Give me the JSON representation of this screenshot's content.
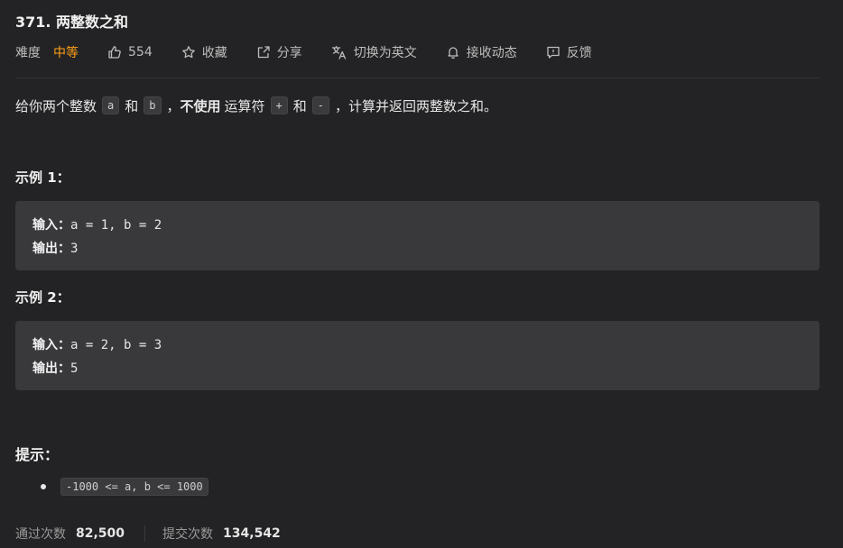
{
  "problem": {
    "title": "371. 两整数之和"
  },
  "meta": {
    "difficulty_label": "难度",
    "difficulty": "中等",
    "difficulty_color": "#ffa116",
    "likes": "554",
    "actions": [
      {
        "label": "收藏",
        "icon": "star-icon"
      },
      {
        "label": "分享",
        "icon": "share-icon"
      },
      {
        "label": "切换为英文",
        "icon": "translate-icon"
      },
      {
        "label": "接收动态",
        "icon": "bell-icon"
      },
      {
        "label": "反馈",
        "icon": "feedback-icon"
      }
    ]
  },
  "description": {
    "part1": "给你两个整数",
    "code_a": "a",
    "and1": "和",
    "code_b": "b",
    "comma1": "，",
    "bold": "不使用",
    "part2": "运算符",
    "code_plus": "+",
    "and2": "和",
    "code_minus": "-",
    "part3": "，计算并返回两整数之和。"
  },
  "examples": [
    {
      "title": "示例 1：",
      "input_label": "输入：",
      "input": "a = 1, b = 2",
      "output_label": "输出：",
      "output": "3"
    },
    {
      "title": "示例 2：",
      "input_label": "输入：",
      "input": "a = 2, b = 3",
      "output_label": "输出：",
      "output": "5"
    }
  ],
  "hints": {
    "title": "提示：",
    "items": [
      "-1000 <= a, b <= 1000"
    ]
  },
  "stats": {
    "passed_label": "通过次数",
    "passed": "82,500",
    "submitted_label": "提交次数",
    "submitted": "134,542"
  }
}
